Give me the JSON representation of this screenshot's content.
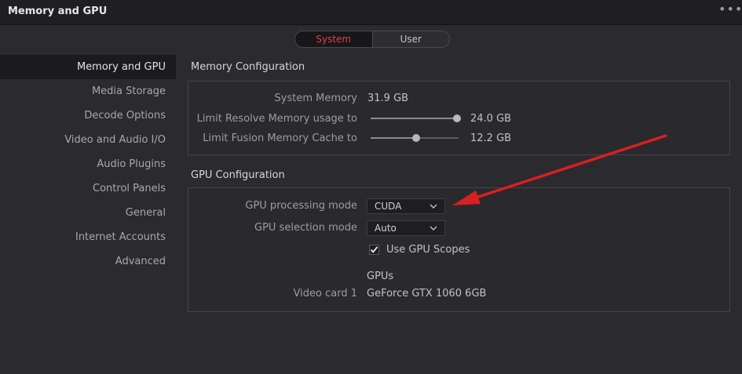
{
  "window": {
    "title": "Memory and GPU",
    "more_label": "•••"
  },
  "tabs": [
    {
      "label": "System",
      "active": true
    },
    {
      "label": "User",
      "active": false
    }
  ],
  "sidebar": {
    "items": [
      {
        "label": "Memory and GPU",
        "active": true
      },
      {
        "label": "Media Storage"
      },
      {
        "label": "Decode Options"
      },
      {
        "label": "Video and Audio I/O"
      },
      {
        "label": "Audio Plugins"
      },
      {
        "label": "Control Panels"
      },
      {
        "label": "General"
      },
      {
        "label": "Internet Accounts"
      },
      {
        "label": "Advanced"
      }
    ]
  },
  "memory": {
    "title": "Memory Configuration",
    "system_memory_label": "System Memory",
    "system_memory_value": "31.9 GB",
    "resolve_label": "Limit Resolve Memory usage to",
    "resolve_value": "24.0 GB",
    "resolve_fraction": 0.98,
    "fusion_label": "Limit Fusion Memory Cache to",
    "fusion_value": "12.2 GB",
    "fusion_fraction": 0.52
  },
  "gpu": {
    "title": "GPU Configuration",
    "processing_mode_label": "GPU processing mode",
    "processing_mode_value": "CUDA",
    "selection_mode_label": "GPU selection mode",
    "selection_mode_value": "Auto",
    "scopes_label": "Use GPU Scopes",
    "scopes_checked": true,
    "gpus_heading": "GPUs",
    "video_card_label": "Video card 1",
    "video_card_value": "GeForce GTX 1060 6GB"
  },
  "colors": {
    "accent": "#e04040",
    "annotation_arrow": "#d8201f"
  }
}
